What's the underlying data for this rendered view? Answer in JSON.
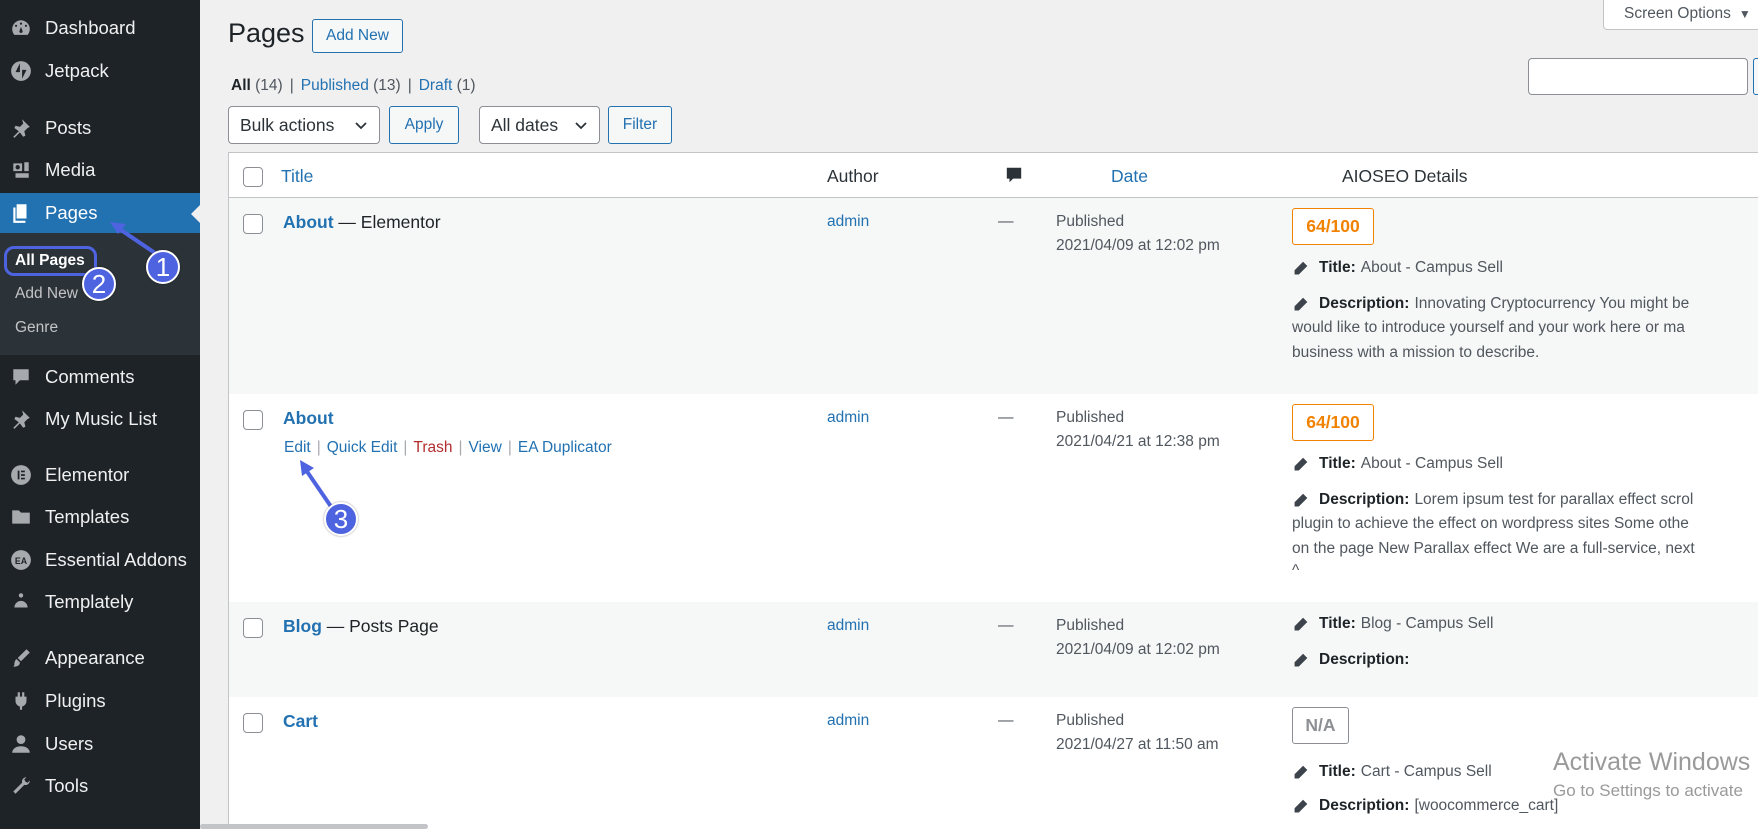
{
  "sidebar": {
    "items": [
      {
        "label": "Dashboard",
        "icon": "dashboard-icon"
      },
      {
        "label": "Jetpack",
        "icon": "jetpack-icon"
      },
      {
        "label": "Posts",
        "icon": "pin-icon"
      },
      {
        "label": "Media",
        "icon": "media-icon"
      },
      {
        "label": "Pages",
        "icon": "pages-icon"
      },
      {
        "label": "Comments",
        "icon": "comment-icon"
      },
      {
        "label": "My Music List",
        "icon": "pin-icon"
      },
      {
        "label": "Elementor",
        "icon": "elementor-icon"
      },
      {
        "label": "Templates",
        "icon": "folder-icon"
      },
      {
        "label": "Essential Addons",
        "icon": "essential-addons-icon"
      },
      {
        "label": "Templately",
        "icon": "templately-icon"
      },
      {
        "label": "Appearance",
        "icon": "brush-icon"
      },
      {
        "label": "Plugins",
        "icon": "plugin-icon"
      },
      {
        "label": "Users",
        "icon": "user-icon"
      },
      {
        "label": "Tools",
        "icon": "wrench-icon"
      }
    ],
    "submenu": [
      "All Pages",
      "Add New",
      "Genre"
    ]
  },
  "header": {
    "title": "Pages",
    "add_new": "Add New",
    "screen_options": "Screen Options"
  },
  "filters": {
    "all": "All",
    "all_count": "(14)",
    "published": "Published",
    "published_count": "(13)",
    "draft": "Draft",
    "draft_count": "(1)",
    "bulk_actions": "Bulk actions",
    "apply": "Apply",
    "all_dates": "All dates",
    "filter": "Filter"
  },
  "table": {
    "columns": {
      "title": "Title",
      "author": "Author",
      "date": "Date",
      "aioseo": "AIOSEO Details"
    },
    "rows": [
      {
        "title": "About",
        "suffix": "— Elementor",
        "author": "admin",
        "comments": "—",
        "status": "Published",
        "date": "2021/04/09 at 12:02 pm",
        "score": "64/100",
        "seo_title_label": "Title:",
        "seo_title": "About - Campus Sell",
        "desc_label": "Description:",
        "desc_lines": [
          "Innovating Cryptocurrency You might be",
          "would like to introduce yourself and your work here or ma",
          "business with a mission to describe."
        ]
      },
      {
        "title": "About",
        "author": "admin",
        "comments": "—",
        "status": "Published",
        "date": "2021/04/21 at 12:38 pm",
        "score": "64/100",
        "seo_title_label": "Title:",
        "seo_title": "About - Campus Sell",
        "desc_label": "Description:",
        "desc_lines": [
          "Lorem ipsum test for parallax effect scrol",
          "plugin to achieve the effect on wordpress sites Some othe",
          "on the page New Parallax effect We are a full-service, next",
          "^"
        ],
        "actions": {
          "edit": "Edit",
          "quick_edit": "Quick Edit",
          "trash": "Trash",
          "view": "View",
          "duplicator": "EA Duplicator",
          "sep": "|"
        }
      },
      {
        "title": "Blog",
        "suffix": "— Posts Page",
        "author": "admin",
        "comments": "—",
        "status": "Published",
        "date": "2021/04/09 at 12:02 pm",
        "seo_title_label": "Title:",
        "seo_title": "Blog - Campus Sell",
        "desc_label": "Description:"
      },
      {
        "title": "Cart",
        "author": "admin",
        "comments": "—",
        "status": "Published",
        "date": "2021/04/27 at 11:50 am",
        "score": "N/A",
        "seo_title_label": "Title:",
        "seo_title": "Cart - Campus Sell",
        "desc_label": "Description:",
        "desc": "[woocommerce_cart]"
      }
    ]
  },
  "annotations": {
    "one": "1",
    "two": "2",
    "three": "3"
  },
  "watermark": {
    "line1": "Activate Windows",
    "line2": "Go to Settings to activate"
  },
  "colors": {
    "sidebar": "#1d2327",
    "accent": "#2271b1",
    "score_orange": "#f18200",
    "annotation": "#4e63e0"
  }
}
